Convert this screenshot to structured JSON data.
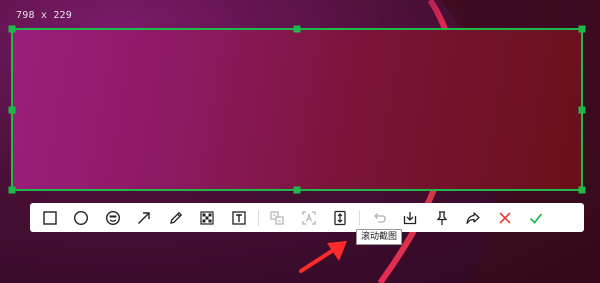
{
  "selection": {
    "size_text": "798 x 229"
  },
  "toolbar": {
    "tools": [
      {
        "name": "rectangle-tool",
        "icon": "rectangle-icon",
        "enabled": true
      },
      {
        "name": "ellipse-tool",
        "icon": "ellipse-icon",
        "enabled": true
      },
      {
        "name": "emoji-tool",
        "icon": "emoji-icon",
        "enabled": true
      },
      {
        "name": "arrow-tool",
        "icon": "arrow-icon",
        "enabled": true
      },
      {
        "name": "pen-tool",
        "icon": "pencil-icon",
        "enabled": true
      },
      {
        "name": "mosaic-tool",
        "icon": "mosaic-icon",
        "enabled": true
      },
      {
        "name": "text-tool",
        "icon": "text-icon",
        "enabled": true
      },
      {
        "name": "translate-tool",
        "icon": "translate-icon",
        "enabled": false
      },
      {
        "name": "ocr-tool",
        "icon": "ocr-icon",
        "enabled": false
      },
      {
        "name": "scroll-capture-tool",
        "icon": "scroll-capture-icon",
        "enabled": true
      },
      {
        "name": "undo-button",
        "icon": "undo-icon",
        "enabled": false
      },
      {
        "name": "save-button",
        "icon": "download-icon",
        "enabled": true
      },
      {
        "name": "pin-button",
        "icon": "pin-icon",
        "enabled": true
      },
      {
        "name": "share-button",
        "icon": "share-icon",
        "enabled": true
      },
      {
        "name": "cancel-button",
        "icon": "close-icon",
        "enabled": true
      },
      {
        "name": "confirm-button",
        "icon": "check-icon",
        "enabled": true
      }
    ],
    "tooltip": "滚动截图"
  },
  "colors": {
    "selection_border": "#1fb84a",
    "cancel": "#e53935",
    "confirm": "#1fb84a",
    "annotation_arrow": "#ff2a2a"
  }
}
